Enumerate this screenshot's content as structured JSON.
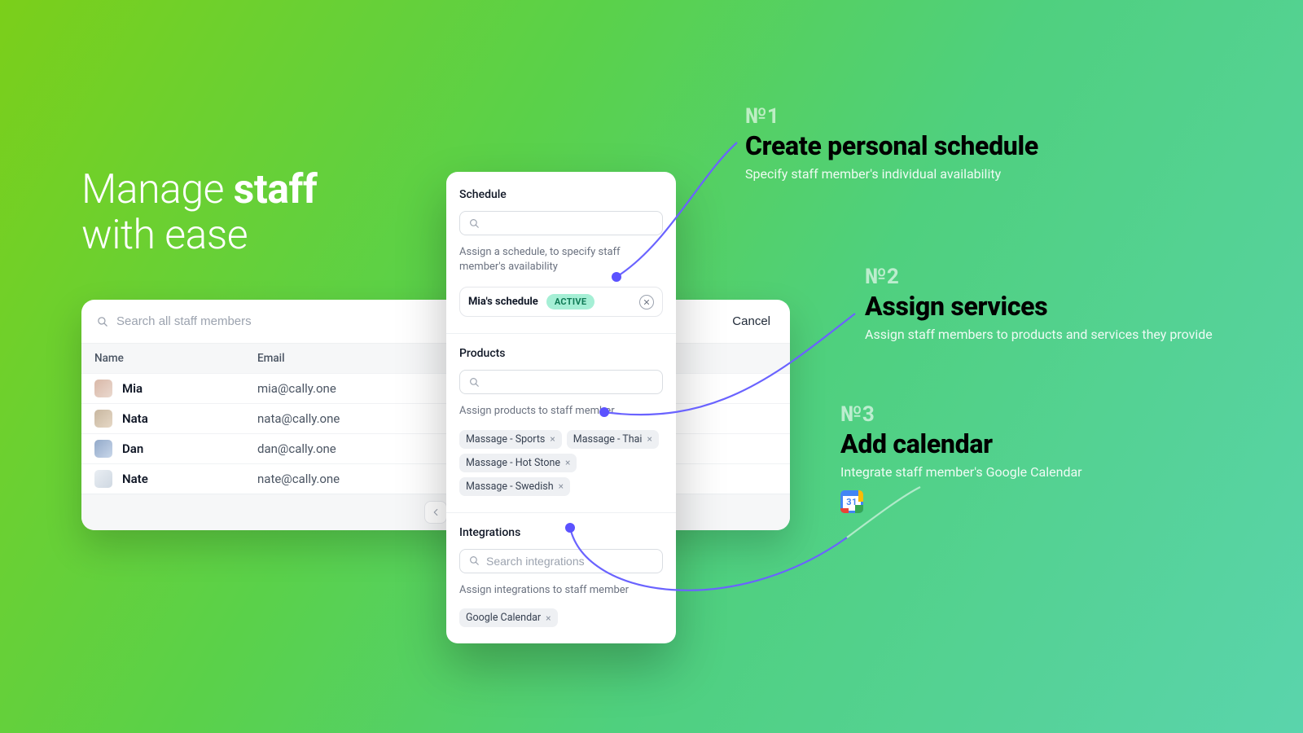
{
  "headline": {
    "line1_pre": "Manage ",
    "line1_strong": "staff",
    "line2": "with ease"
  },
  "staff_table": {
    "search_placeholder": "Search all staff members",
    "cancel_label": "Cancel",
    "columns": {
      "name": "Name",
      "email": "Email"
    },
    "rows": [
      {
        "name": "Mia",
        "email": "mia@cally.one"
      },
      {
        "name": "Nata",
        "email": "nata@cally.one"
      },
      {
        "name": "Dan",
        "email": "dan@cally.one"
      },
      {
        "name": "Nate",
        "email": "nate@cally.one"
      }
    ]
  },
  "detail": {
    "schedule": {
      "title": "Schedule",
      "search_placeholder": "",
      "help": "Assign a schedule, to specify staff member's availability",
      "name": "Mia's schedule",
      "badge": "ACTIVE"
    },
    "products": {
      "title": "Products",
      "search_placeholder": "",
      "help": "Assign products to staff member",
      "chips": [
        "Massage - Sports",
        "Massage - Thai",
        "Massage - Hot Stone",
        "Massage - Swedish"
      ]
    },
    "integrations": {
      "title": "Integrations",
      "search_placeholder": "Search integrations",
      "help": "Assign integrations to staff member",
      "chips": [
        "Google Calendar"
      ]
    }
  },
  "callouts": {
    "c1": {
      "num": "№1",
      "title": "Create personal schedule",
      "desc": "Specify staff member's individual availability"
    },
    "c2": {
      "num": "№2",
      "title": "Assign services",
      "desc": "Assign staff members to products and services they provide"
    },
    "c3": {
      "num": "№3",
      "title": "Add calendar",
      "desc": "Integrate staff member's Google Calendar",
      "icon_day": "31"
    }
  }
}
